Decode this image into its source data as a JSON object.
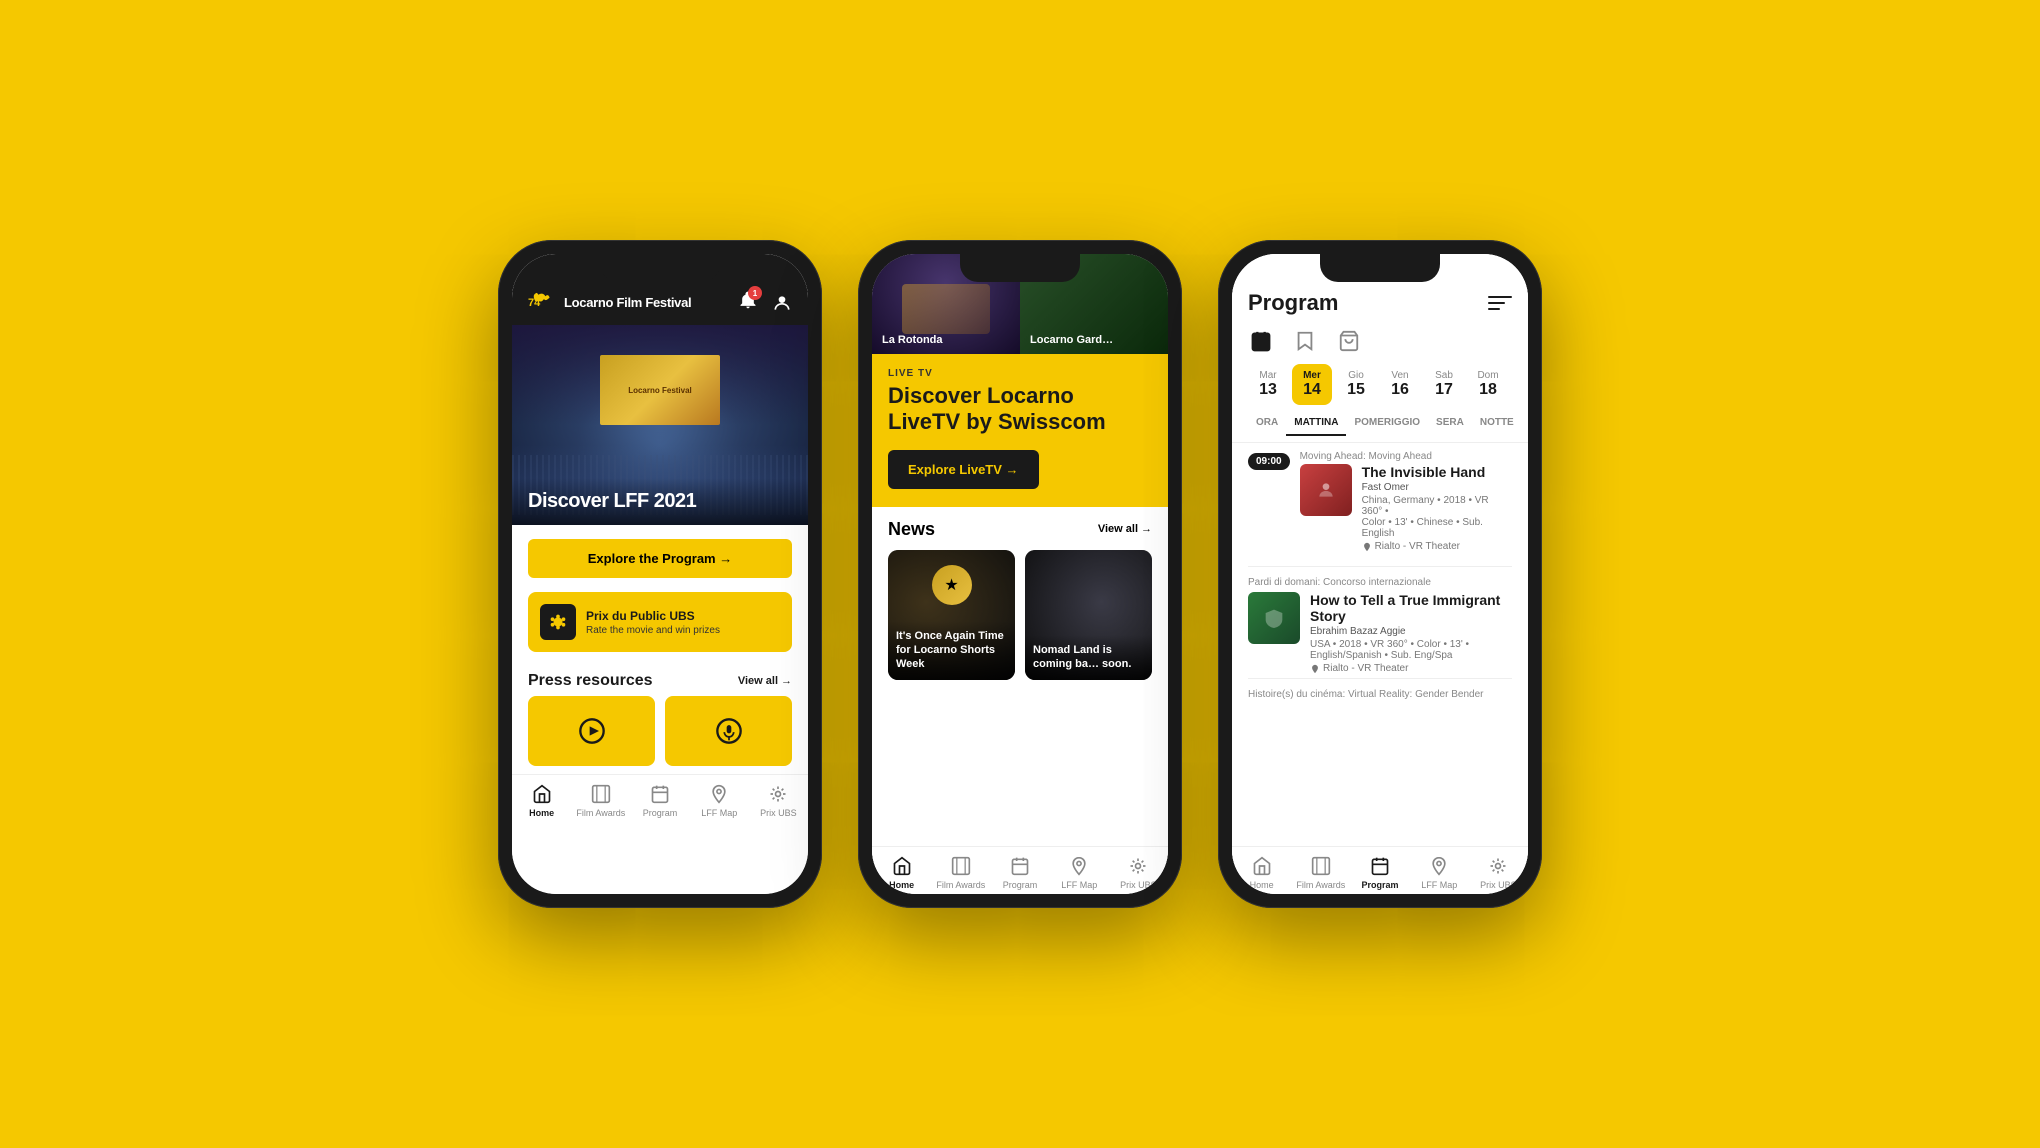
{
  "background": "#F5C800",
  "phone1": {
    "header": {
      "logo_num": "74",
      "logo_text": "Locarno Film Festival",
      "bell_badge": "1"
    },
    "hero": {
      "screen_text": "Locarno Festival",
      "title": "Discover LFF 2021"
    },
    "cta_button": "Explore the Program →",
    "promo": {
      "title": "Prix du Public UBS",
      "subtitle": "Rate the movie and win prizes"
    },
    "press_section": {
      "title": "Press resources",
      "view_all": "View all"
    },
    "nav": {
      "items": [
        {
          "label": "Home",
          "active": true
        },
        {
          "label": "Film Awards",
          "active": false
        },
        {
          "label": "Program",
          "active": false
        },
        {
          "label": "LFF Map",
          "active": false
        },
        {
          "label": "Prix UBS",
          "active": false
        }
      ]
    }
  },
  "phone2": {
    "top_images": [
      {
        "label": "La Rotonda"
      },
      {
        "label": "Locarno Gard…"
      }
    ],
    "hero": {
      "live_badge": "LIVE TV",
      "title": "Discover Locarno\nLiveTV by Swisscom",
      "cta_button": "Explore LiveTV →"
    },
    "news": {
      "title": "News",
      "view_all": "View all",
      "cards": [
        {
          "text": "It's Once Again Time for Locarno Shorts Week"
        },
        {
          "text": "Nomad Land is coming ba… soon."
        }
      ]
    },
    "nav": {
      "items": [
        {
          "label": "Home",
          "active": true
        },
        {
          "label": "Film Awards",
          "active": false
        },
        {
          "label": "Program",
          "active": false
        },
        {
          "label": "LFF Map",
          "active": false
        },
        {
          "label": "Prix UBS",
          "active": false
        }
      ]
    }
  },
  "phone3": {
    "header": {
      "title": "Program"
    },
    "days": [
      {
        "name": "Mar",
        "num": "13",
        "active": false
      },
      {
        "name": "Mer",
        "num": "14",
        "active": true
      },
      {
        "name": "Gio",
        "num": "15",
        "active": false
      },
      {
        "name": "Ven",
        "num": "16",
        "active": false
      },
      {
        "name": "Sab",
        "num": "17",
        "active": false
      },
      {
        "name": "Dom",
        "num": "18",
        "active": false
      }
    ],
    "time_tabs": [
      {
        "label": "ORA",
        "active": false
      },
      {
        "label": "MATTINA",
        "active": true
      },
      {
        "label": "POMERIGGIO",
        "active": false
      },
      {
        "label": "SERA",
        "active": false
      },
      {
        "label": "NOTTE",
        "active": false
      }
    ],
    "schedule": [
      {
        "time": "09:00",
        "section_label": "Moving Ahead: Moving Ahead",
        "title": "The Invisible Hand",
        "subtitle": "Fast Omer",
        "meta": "China, Germany • 2018 • VR 360° • Color • 13' • Chinese • Sub. English",
        "location": "Rialto - VR Theater"
      },
      {
        "section_label": "Pardi di domani: Concorso internazionale",
        "title": "How to Tell a True Immigrant Story",
        "subtitle": "Ebrahim Bazaz Aggie",
        "meta": "USA • 2018 • VR 360° • Color • 13' • English/Spanish • Sub. Eng/Spa",
        "location": "Rialto - VR Theater"
      },
      {
        "section_label": "Histoire(s) du cinéma: Virtual Reality: Gender Bender"
      }
    ],
    "nav": {
      "items": [
        {
          "label": "Home",
          "active": false
        },
        {
          "label": "Film Awards",
          "active": false
        },
        {
          "label": "Program",
          "active": true
        },
        {
          "label": "LFF Map",
          "active": false
        },
        {
          "label": "Prix UBS",
          "active": false
        }
      ]
    }
  }
}
